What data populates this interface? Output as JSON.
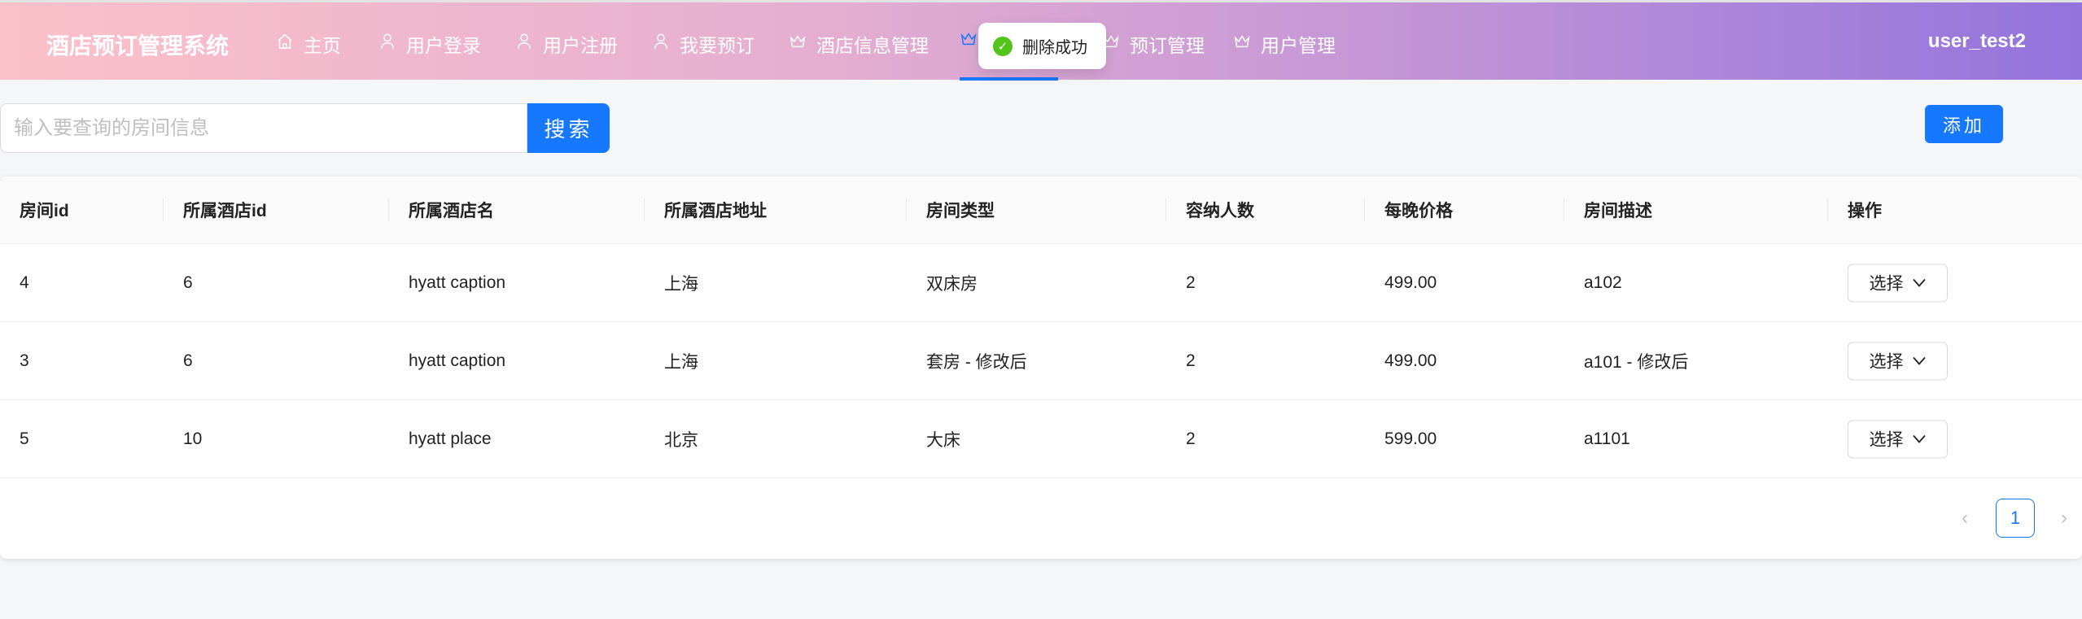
{
  "header": {
    "logo": "酒店预订管理系统",
    "user": "user_test2",
    "nav": [
      {
        "label": "主页",
        "icon": "home-icon"
      },
      {
        "label": "用户登录",
        "icon": "user-icon"
      },
      {
        "label": "用户注册",
        "icon": "user-icon"
      },
      {
        "label": "我要预订",
        "icon": "user-icon"
      },
      {
        "label": "酒店信息管理",
        "icon": "crown-icon"
      },
      {
        "label": "",
        "icon": "crown-icon"
      },
      {
        "label": "预订管理",
        "icon": "crown-icon"
      },
      {
        "label": "用户管理",
        "icon": "crown-icon"
      }
    ]
  },
  "toast": {
    "text": "删除成功"
  },
  "toolbar": {
    "search_placeholder": "输入要查询的房间信息",
    "search_value": "",
    "search_label": "搜索",
    "add_label": "添加"
  },
  "table": {
    "columns": [
      "房间id",
      "所属酒店id",
      "所属酒店名",
      "所属酒店地址",
      "房间类型",
      "容纳人数",
      "每晚价格",
      "房间描述",
      "操作"
    ],
    "rows": [
      [
        "4",
        "6",
        "hyatt caption",
        "上海",
        "双床房",
        "2",
        "499.00",
        "a102"
      ],
      [
        "3",
        "6",
        "hyatt caption",
        "上海",
        "套房 - 修改后",
        "2",
        "499.00",
        "a101 - 修改后"
      ],
      [
        "5",
        "10",
        "hyatt place",
        "北京",
        "大床",
        "2",
        "599.00",
        "a1101"
      ]
    ],
    "action_label": "选择"
  },
  "pagination": {
    "current": "1"
  }
}
